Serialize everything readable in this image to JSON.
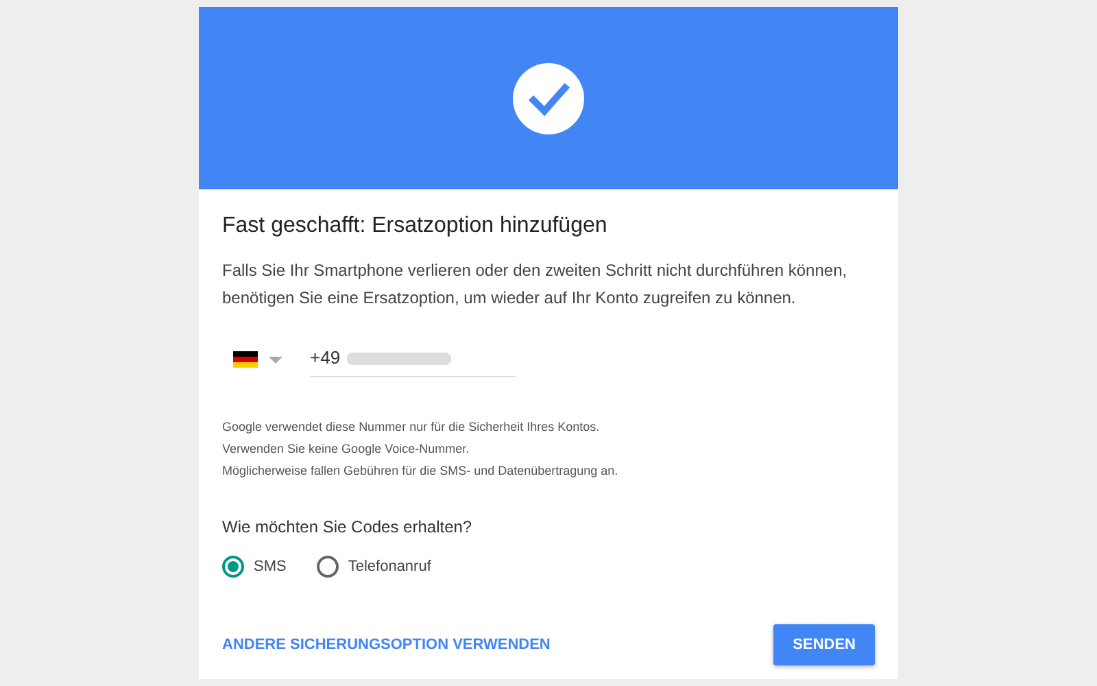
{
  "title": "Fast geschafft: Ersatzoption hinzufügen",
  "description": "Falls Sie Ihr Smartphone verlieren oder den zweiten Schritt nicht durchführen können, benötigen Sie eine Ersatzoption, um wieder auf Ihr Konto zugreifen zu können.",
  "phone": {
    "country_code": "+49"
  },
  "notes": [
    "Google verwendet diese Nummer nur für die Sicherheit Ihres Kontos.",
    "Verwenden Sie keine Google Voice-Nummer.",
    "Möglicherweise fallen Gebühren für die SMS- und Datenübertragung an."
  ],
  "question": "Wie möchten Sie Codes erhalten?",
  "options": [
    {
      "label": "SMS",
      "selected": true
    },
    {
      "label": "Telefonanruf",
      "selected": false
    }
  ],
  "link": "ANDERE SICHERUNGSOPTION VERWENDEN",
  "button": "SENDEN"
}
